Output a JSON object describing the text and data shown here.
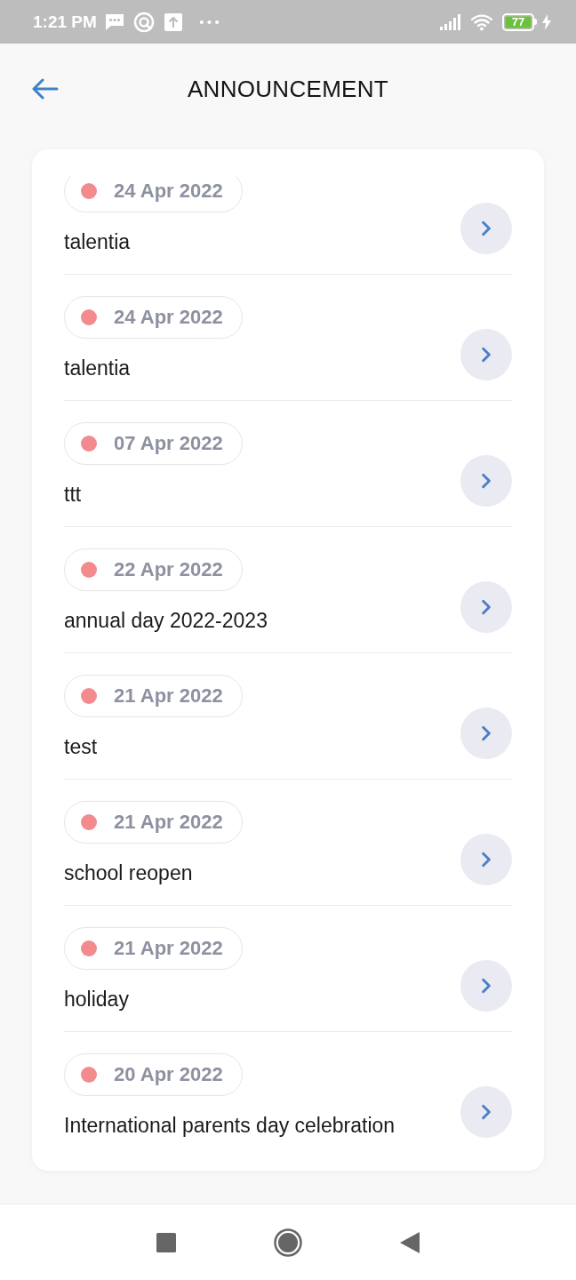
{
  "status_bar": {
    "time": "1:21 PM",
    "battery": "77"
  },
  "header": {
    "title": "ANNOUNCEMENT"
  },
  "announcements": [
    {
      "date": "24 Apr 2022",
      "title": "talentia"
    },
    {
      "date": "24 Apr 2022",
      "title": "talentia"
    },
    {
      "date": "07 Apr 2022",
      "title": "ttt"
    },
    {
      "date": "22 Apr 2022",
      "title": "annual day 2022-2023"
    },
    {
      "date": "21 Apr 2022",
      "title": "test"
    },
    {
      "date": "21 Apr 2022",
      "title": "school reopen"
    },
    {
      "date": "21 Apr 2022",
      "title": "holiday"
    },
    {
      "date": "20 Apr 2022",
      "title": "International parents day celebration"
    }
  ]
}
